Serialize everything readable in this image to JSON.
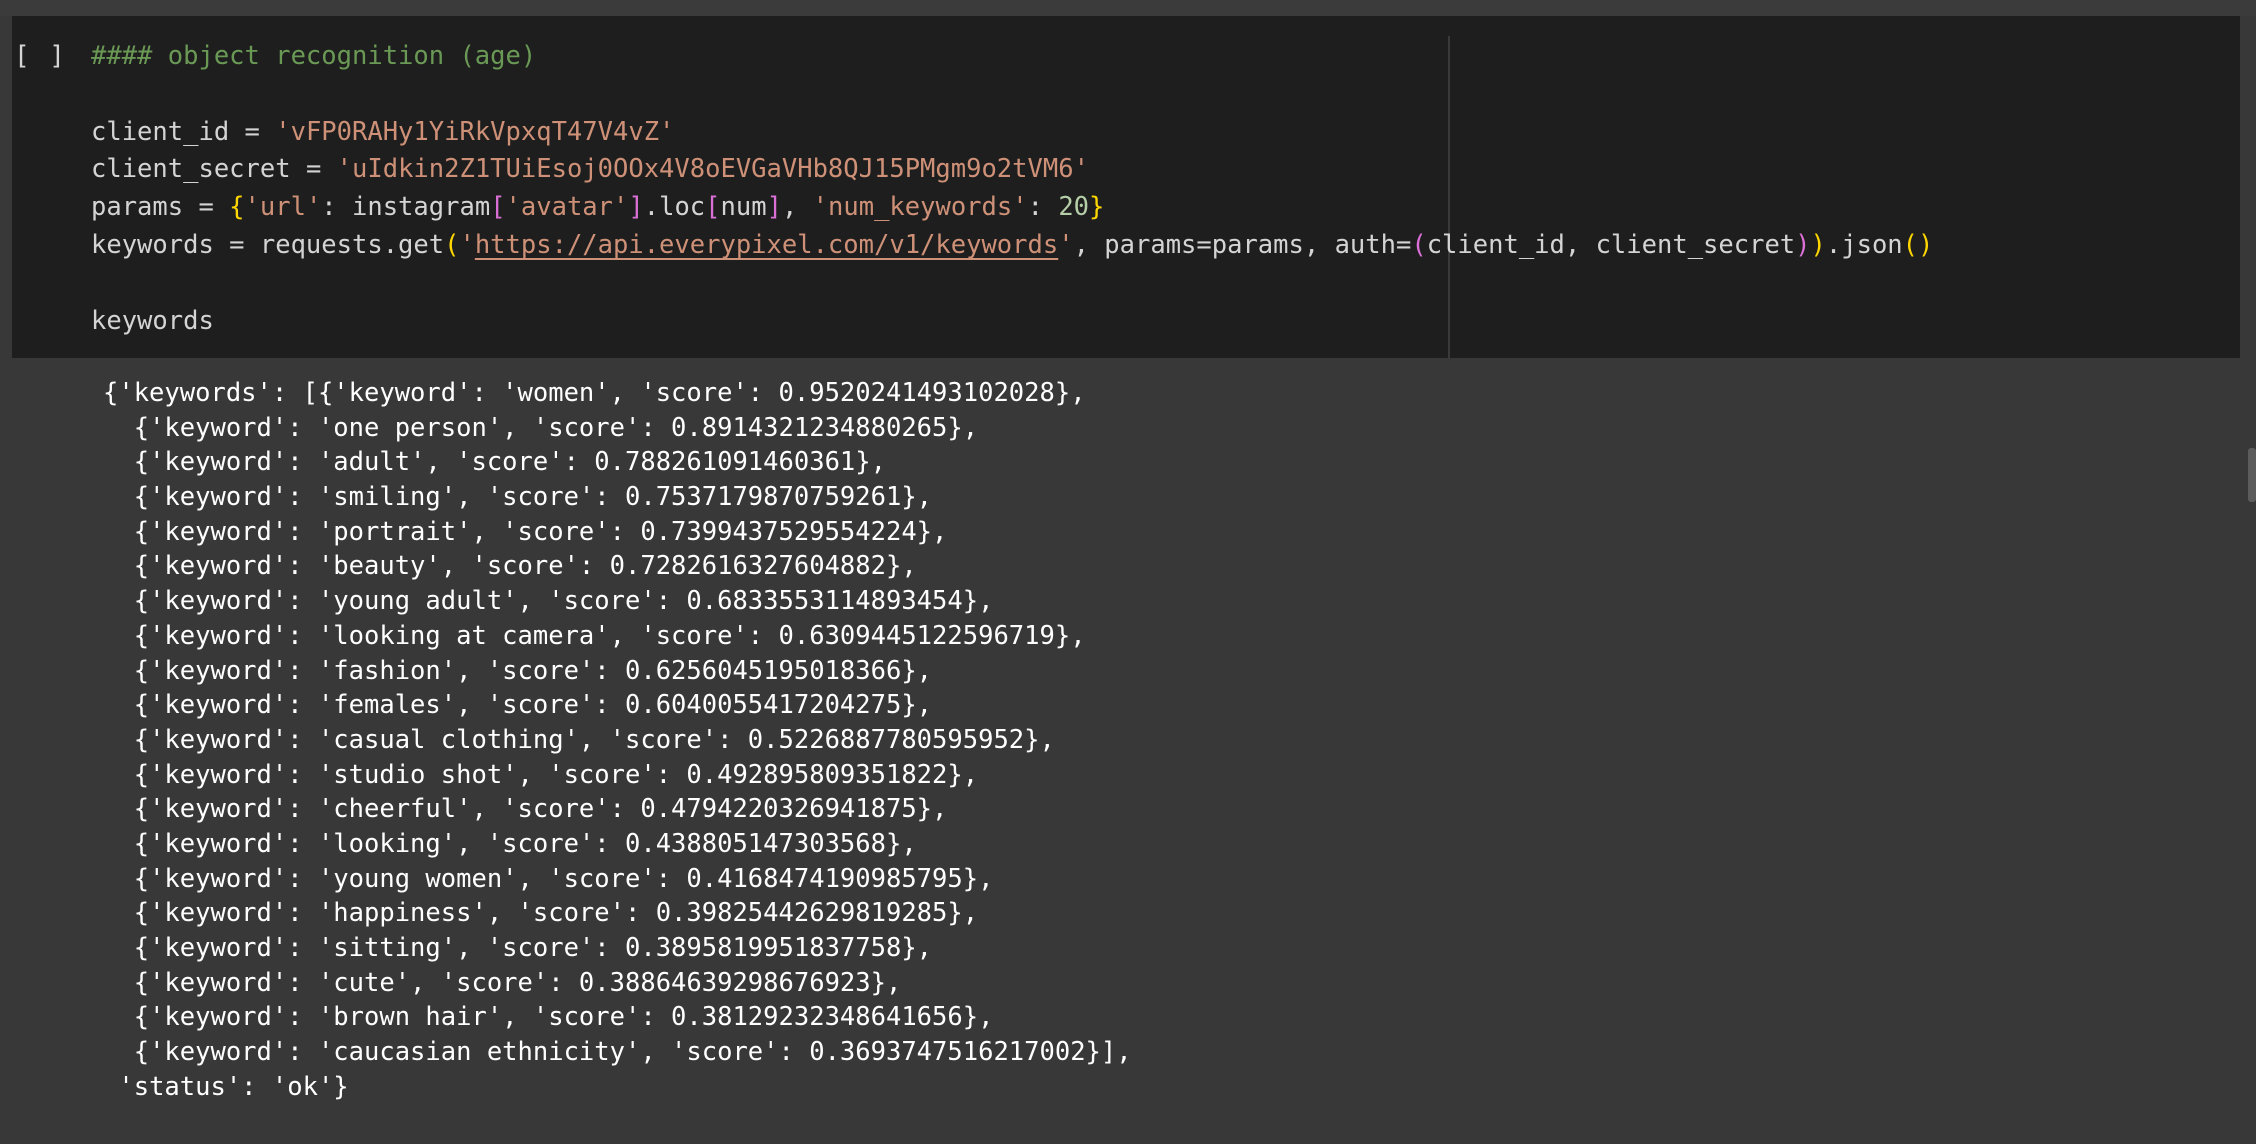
{
  "cell": {
    "run_label": "[ ]",
    "code": {
      "comment": "#### object recognition (age)",
      "l_client_id": {
        "name": "client_id",
        "eq": " = ",
        "value": "'vFP0RAHy1YiRkVpxqT47V4vZ'"
      },
      "l_client_secret": {
        "name": "client_secret",
        "eq": " = ",
        "value": "'uIdkin2Z1TUiEsoj0OOx4V8oEVGaVHb8QJ15PMgm9o2tVM6'"
      },
      "l_params": {
        "lhs": "params = ",
        "open": "{",
        "k1": "'url'",
        "sep1": ": instagram",
        "ob": "[",
        "k2": "'avatar'",
        "cb": "]",
        "loc": ".loc",
        "ob2": "[",
        "num": "num",
        "cb2": "]",
        "comma": ", ",
        "k3": "'num_keywords'",
        "colon": ": ",
        "n": "20",
        "close": "}"
      },
      "l_keywords": {
        "lhs": "keywords = requests.get",
        "p1": "(",
        "q1": "'",
        "url": "https://api.everypixel.com/v1/keywords",
        "q2": "'",
        "mid": ", params=params, auth=",
        "p2": "(",
        "args": "client_id, client_secret",
        "p3": ")",
        "p4": ")",
        "json": ".json",
        "p5": "()"
      },
      "last": "keywords"
    }
  },
  "output": {
    "head": "{'keywords': [",
    "rows": [
      "{'keyword': 'women', 'score': 0.9520241493102028},",
      "{'keyword': 'one person', 'score': 0.8914321234880265},",
      "{'keyword': 'adult', 'score': 0.788261091460361},",
      "{'keyword': 'smiling', 'score': 0.7537179870759261},",
      "{'keyword': 'portrait', 'score': 0.7399437529554224},",
      "{'keyword': 'beauty', 'score': 0.7282616327604882},",
      "{'keyword': 'young adult', 'score': 0.6833553114893454},",
      "{'keyword': 'looking at camera', 'score': 0.6309445122596719},",
      "{'keyword': 'fashion', 'score': 0.6256045195018366},",
      "{'keyword': 'females', 'score': 0.6040055417204275},",
      "{'keyword': 'casual clothing', 'score': 0.5226887780595952},",
      "{'keyword': 'studio shot', 'score': 0.492895809351822},",
      "{'keyword': 'cheerful', 'score': 0.4794220326941875},",
      "{'keyword': 'looking', 'score': 0.438805147303568},",
      "{'keyword': 'young women', 'score': 0.4168474190985795},",
      "{'keyword': 'happiness', 'score': 0.39825442629819285},",
      "{'keyword': 'sitting', 'score': 0.3895819951837758},",
      "{'keyword': 'cute', 'score': 0.38864639298676923},",
      "{'keyword': 'brown hair', 'score': 0.38129232348641656},",
      "{'keyword': 'caucasian ethnicity', 'score': 0.3693747516217002}],"
    ],
    "status": "'status': 'ok'}"
  }
}
